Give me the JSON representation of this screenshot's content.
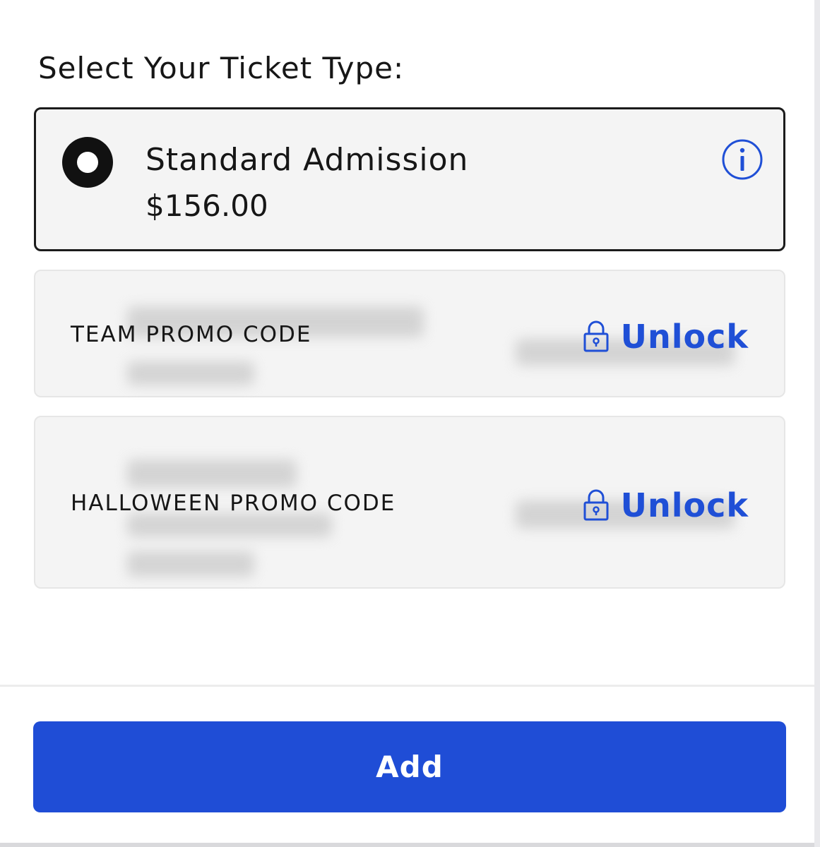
{
  "heading": "Select Your Ticket Type:",
  "tickets": [
    {
      "name": "Standard Admission",
      "price": "$156.00",
      "selected": true,
      "icon": "info-icon"
    }
  ],
  "promos": [
    {
      "label": "TEAM PROMO CODE",
      "action": "Unlock",
      "icon": "lock-icon"
    },
    {
      "label": "HALLOWEEN PROMO CODE",
      "action": "Unlock",
      "icon": "lock-icon"
    }
  ],
  "add_button": "Add",
  "colors": {
    "accent": "#1f4dd6",
    "card_bg": "#f4f4f4",
    "text": "#161616"
  }
}
